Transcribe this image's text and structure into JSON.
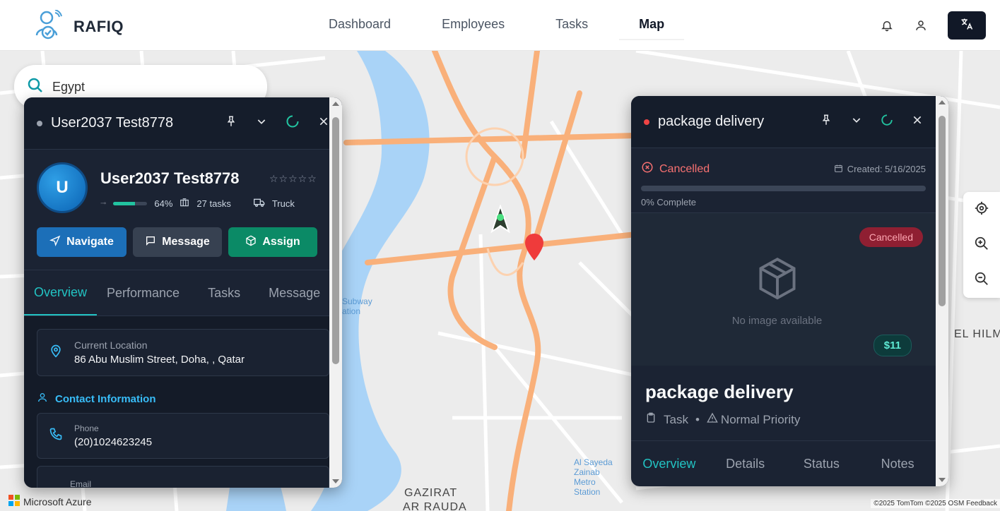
{
  "app": {
    "name": "RAFIQ"
  },
  "nav": {
    "items": [
      "Dashboard",
      "Employees",
      "Tasks",
      "Map"
    ],
    "active": "Map"
  },
  "header_icons": [
    "bell-icon",
    "user-icon",
    "translate-icon"
  ],
  "search": {
    "value": "Egypt"
  },
  "map": {
    "labels": [
      "GAZIRAT",
      "AR RAUDA",
      "EL HILM",
      "Al Sayeda Zainab Metro Station",
      "Subway",
      "ation"
    ],
    "attribution": "©2025 TomTom ©2025 OSM Feedback",
    "provider": "Microsoft Azure"
  },
  "employee_panel": {
    "header_title": "User2037 Test8778",
    "avatar_initial": "U",
    "name": "User2037 Test8778",
    "rating_stars": "☆☆☆☆☆",
    "progress_percent": 64,
    "progress_label": "64%",
    "tasks_label": "27 tasks",
    "vehicle": "Truck",
    "actions": {
      "navigate": "Navigate",
      "message": "Message",
      "assign": "Assign"
    },
    "tabs": [
      "Overview",
      "Performance",
      "Tasks",
      "Message"
    ],
    "active_tab": "Overview",
    "location": {
      "label": "Current Location",
      "value": "86 Abu Muslim Street, Doha, , Qatar"
    },
    "contact_title": "Contact Information",
    "phone": {
      "label": "Phone",
      "value": "(20)1024623245"
    },
    "email": {
      "label": "Email"
    }
  },
  "task_panel": {
    "header_title": "package delivery",
    "status": "Cancelled",
    "created": "Created: 5/16/2025",
    "progress_percent": 0,
    "complete_label": "0% Complete",
    "badge": "Cancelled",
    "no_image": "No image available",
    "price": "$11",
    "title": "package delivery",
    "type": "Task",
    "separator": "•",
    "priority": "Normal Priority",
    "tabs": [
      "Overview",
      "Details",
      "Status",
      "Notes"
    ],
    "active_tab": "Overview"
  },
  "colors": {
    "accent": "#22c3c3",
    "cancel": "#f87171",
    "panel": "#1b2333",
    "river": "#a9d3f7",
    "road": "#f9b07a"
  }
}
